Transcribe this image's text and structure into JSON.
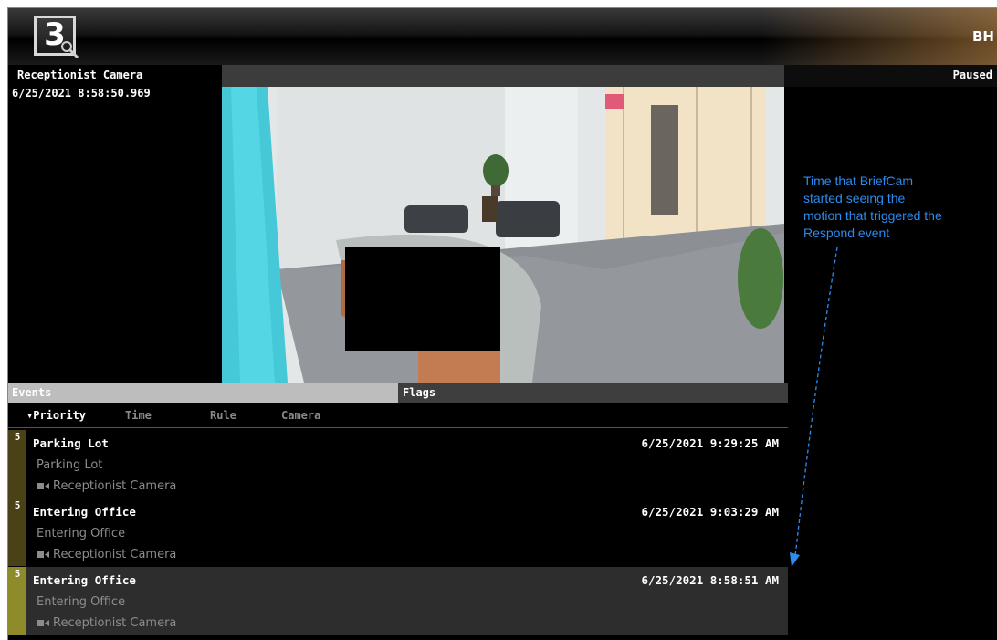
{
  "app": {
    "logo_text": "3",
    "title_partial": "BH"
  },
  "camera": {
    "name": "Receptionist Camera",
    "timestamp": "6/25/2021 8:58:50.969",
    "status": "Paused"
  },
  "annotation": {
    "text": "Time that BriefCam\nstarted  seeing the\nmotion that triggered  the\nRespond event",
    "color": "#2c8cf0"
  },
  "tabs": [
    {
      "label": "Events"
    },
    {
      "label": "Flags"
    }
  ],
  "sort": {
    "priority": "▾Priority",
    "time": "Time",
    "rule": "Rule",
    "camera": "Camera"
  },
  "events": [
    {
      "priority": "5",
      "name": "Parking Lot",
      "rule": "Parking Lot",
      "camera": "Receptionist Camera",
      "time": "6/25/2021 9:29:25 AM"
    },
    {
      "priority": "5",
      "name": "Entering Office",
      "rule": "Entering Office",
      "camera": "Receptionist Camera",
      "time": "6/25/2021 9:03:29 AM"
    },
    {
      "priority": "5",
      "name": "Entering Office",
      "rule": "Entering Office",
      "camera": "Receptionist Camera",
      "time": "6/25/2021 8:58:51 AM",
      "selected": true
    }
  ],
  "colors": {
    "priority_bar": "#4a4216",
    "priority_bar_selected": "#8e8b2a",
    "selected_row": "#2d2d2d",
    "annotation": "#2c8cf0"
  },
  "icons": {
    "camera": "video-camera-icon",
    "logo": "magnifier-icon"
  }
}
